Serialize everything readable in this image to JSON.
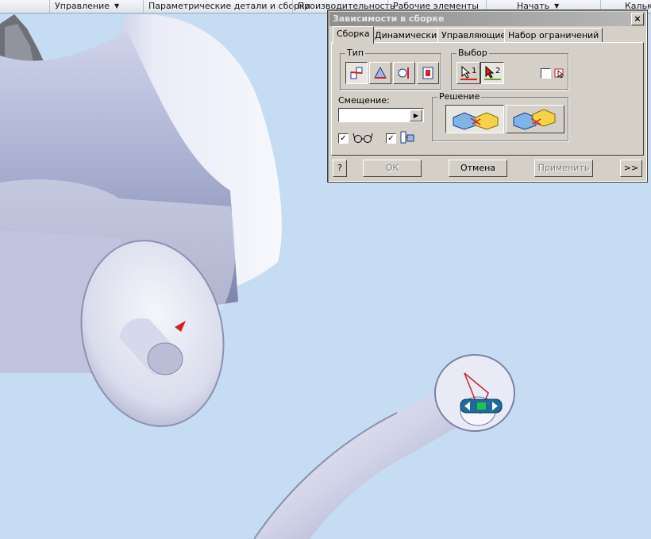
{
  "ribbon": {
    "items": [
      {
        "label": "Управление",
        "has_caret": true
      },
      {
        "label": "Параметрические детали и сборки"
      },
      {
        "label": "Производительность"
      },
      {
        "label": "Рабочие элементы"
      },
      {
        "label": "Начать",
        "has_caret": true
      },
      {
        "label": "Калькуля"
      }
    ]
  },
  "dialog": {
    "title": "Зависимости в сборке",
    "close_label": "×",
    "tabs": [
      "Сборка",
      "Динамические",
      "Управляющие",
      "Набор ограничений"
    ],
    "active_tab": "Сборка",
    "type_group": {
      "label": "Тип",
      "buttons": [
        "mate-icon",
        "angle-icon",
        "tangent-icon",
        "insert-icon"
      ],
      "selected": "mate-icon"
    },
    "selection_group": {
      "label": "Выбор",
      "first": "1",
      "second": "2",
      "first_color": "#e0201b",
      "second_color": "#5aa832",
      "pick_part_first_checked": false
    },
    "offset": {
      "label": "Смещение:",
      "value": ""
    },
    "show_preview_checked": true,
    "predict_offset_checked": true,
    "solution_group": {
      "label": "Решение",
      "selected": "mate"
    },
    "buttons": {
      "help": "?",
      "ok": "ОК",
      "cancel": "Отмена",
      "apply": "Применить",
      "more": ">>"
    }
  },
  "colors": {
    "viewport_bg": "#c6dcf2",
    "model": "#dfe3f0",
    "marker_red": "#d21f2b",
    "marker_green": "#22c24a",
    "dialog_bg": "#d4d0c8"
  }
}
